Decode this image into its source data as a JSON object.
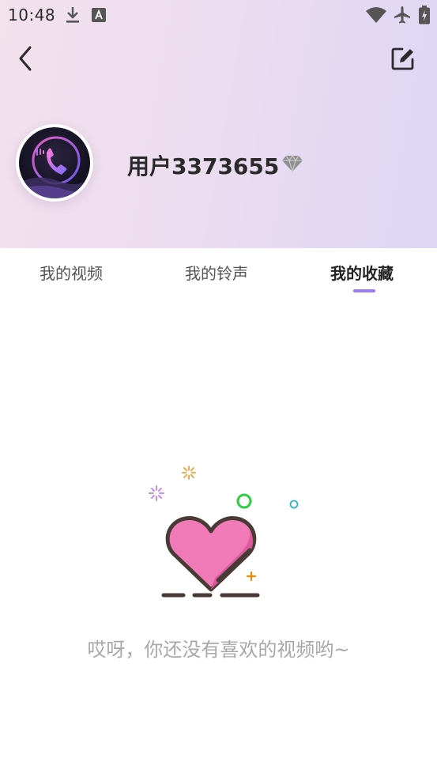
{
  "status_bar": {
    "time": "10:48",
    "icons": [
      "download-icon",
      "a-icon",
      "wifi-icon",
      "airplane-icon",
      "battery-icon"
    ]
  },
  "toolbar": {
    "back_icon": "chevron-left-icon",
    "edit_icon": "edit-icon"
  },
  "profile": {
    "username": "用户3373655",
    "badge_icon": "diamond-icon"
  },
  "tabs": [
    {
      "label": "我的视频",
      "active": false
    },
    {
      "label": "我的铃声",
      "active": false
    },
    {
      "label": "我的收藏",
      "active": true
    }
  ],
  "empty_state": {
    "message": "哎呀，你还没有喜欢的视频哟~",
    "illustration": "heart-icon"
  },
  "colors": {
    "accent": "#9b7ded",
    "heart": "#f07ab8",
    "empty_text": "#a8a8a8"
  }
}
